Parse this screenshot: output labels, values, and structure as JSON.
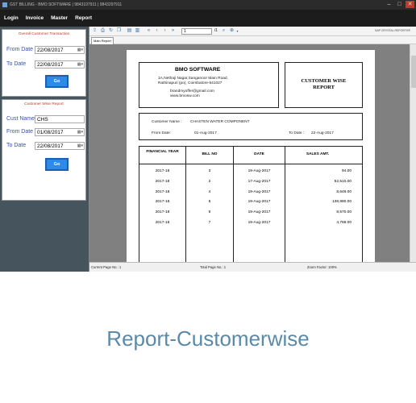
{
  "window": {
    "title": "GST BILLING - BMO SOFTWARE | 9843197911 | 9843297911"
  },
  "menu": {
    "items": [
      "Login",
      "Invoice",
      "Master",
      "Report"
    ]
  },
  "sidebar": {
    "overall": {
      "title": "Overall Customer Transaction",
      "from_label": "From Date",
      "from_value": "22/08/2017",
      "to_label": "To Date",
      "to_value": "22/08/2017",
      "go": "Go"
    },
    "customer": {
      "title": "Customer Wise Report",
      "cust_label": "Cust Name",
      "cust_value": "CHS",
      "from_label": "From Date",
      "from_value": "01/08/2017",
      "to_label": "To Date",
      "to_value": "22/08/2017",
      "go": "Go"
    }
  },
  "viewer": {
    "page_input": "1",
    "page_total": "/1",
    "brand": "SAP CRYSTAL REPORTS®",
    "tab": "Main Report",
    "status": {
      "current": "Current Page No.: 1",
      "total": "Total Page No.: 1",
      "zoom": "Zoom Factor: 100%"
    }
  },
  "report": {
    "company": "BMO SOFTWARE",
    "address1": "1A,Nethaji Nagar,Sanganoor Main Road,",
    "address2": "Rathinapuri (po), Coimbatore-641027",
    "email": "brandmyoffer@gmail.com",
    "web": "www.bmosw.com",
    "title_line1": "CUSTOMER WISE",
    "title_line2": "REPORT",
    "customer_name_label": "Customer Name",
    "customer_name_sep": ":",
    "customer_name": "CHASTEN WATER COMPONENT",
    "from_label": "From Date",
    "from_sep": ":",
    "from_value": "01-Aug-2017",
    "to_label": "To Date",
    "to_sep": ":",
    "to_value": "22-Aug-2017",
    "columns": [
      "FINANCIAL YEAR",
      "BILL NO",
      "DATE",
      "SALES AMT."
    ],
    "rows": [
      [
        "2017-18",
        "3",
        "19-Aug-2017",
        "94.00"
      ],
      [
        "2017-18",
        "2",
        "17-Aug-2017",
        "52,510.00"
      ],
      [
        "2017-18",
        "4",
        "19-Aug-2017",
        "8,649.00"
      ],
      [
        "2017-18",
        "5",
        "19-Aug-2017",
        "138,980.00"
      ],
      [
        "2017-18",
        "6",
        "19-Aug-2017",
        "8,570.00"
      ],
      [
        "2017-18",
        "7",
        "19-Aug-2017",
        "4,768.00"
      ]
    ]
  },
  "caption": "Report-Customerwise"
}
